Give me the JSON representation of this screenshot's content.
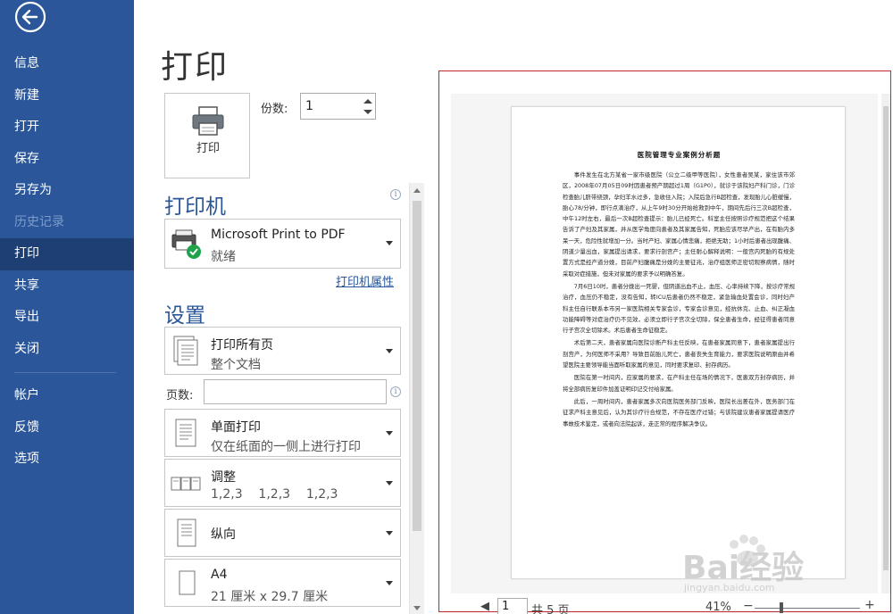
{
  "sidebar": {
    "items": [
      {
        "label": "信息",
        "state": "normal"
      },
      {
        "label": "新建",
        "state": "normal"
      },
      {
        "label": "打开",
        "state": "normal"
      },
      {
        "label": "保存",
        "state": "normal"
      },
      {
        "label": "另存为",
        "state": "normal"
      },
      {
        "label": "历史记录",
        "state": "disabled"
      },
      {
        "label": "打印",
        "state": "active"
      },
      {
        "label": "共享",
        "state": "normal"
      },
      {
        "label": "导出",
        "state": "normal"
      },
      {
        "label": "关闭",
        "state": "normal"
      }
    ],
    "lower_items": [
      {
        "label": "帐户"
      },
      {
        "label": "反馈"
      },
      {
        "label": "选项"
      }
    ],
    "accent_color": "#2b579a"
  },
  "main": {
    "title": "打印",
    "print_button_label": "打印",
    "copies_label": "份数:",
    "copies_value": "1",
    "printer_section_title": "打印机",
    "printer": {
      "name": "Microsoft Print to PDF",
      "status": "就绪"
    },
    "printer_properties_link": "打印机属性",
    "settings_section_title": "设置",
    "settings": {
      "range": {
        "title": "打印所有页",
        "subtitle": "整个文档"
      },
      "pages_label": "页数:",
      "pages_value": "",
      "sides": {
        "title": "单面打印",
        "subtitle": "仅在纸面的一侧上进行打印"
      },
      "collate": {
        "title": "调整",
        "subtitle": "1,2,3    1,2,3    1,2,3"
      },
      "orientation": {
        "title": "纵向"
      },
      "paper": {
        "title": "A4",
        "subtitle": "21 厘米 x 29.7 厘米"
      }
    }
  },
  "preview": {
    "document_title": "医院管理专业案例分析题",
    "paragraphs": [
      "事件发生在北方某省一家市级医院（公立二级甲等医院），女性患者吴某，家住该市郊区，2008年07月05日09时因患者预产期超过1周（G1P0），就诊于该院妇产科门诊，门诊检查胎儿脐带绕颈，孕妇羊水过多，急收住入院；入院后急行B超检查，发现胎儿心脏缓慢，胎心78/分钟，即行点滴治疗，从上午9时30分开始抢救到中午，期间先后行三次B超检查，中午12时左右，最后一次B超检查提示：胎儿已经死亡。科室主任按照诊疗规范把这个结果告诉了产妇及其家属，并从医学角度向患者及其家属告知，死胎应该尽早产出，在有胎内多呆一天，危险性就增加一分。当时产妇、家属心情悲痛，拒绝无助；1小时后患者出现腹痛、阴道少量出血，家属提出请求，要求行剖宫产；主任耐心解释说明：一般宫内死胎的有规处置方式是经产道分娩，目前产妇腹痛是分娩的主要征兆，治疗组医师正密切观察病情，随时采取对症措施，但未对家属的要求予以明确答复。",
      "7月6日10时，患者分娩出一死婴，但阴道出血不止，血压、心率持续下降，按诊疗常规治疗，血压仍不稳定，没有告知，转ICU后患者仍然不稳定，紧急输血处置会诊，同时妇产科主任自行联系本市另一家医院相关专家会诊，专家会诊意见，经抗休克、止血、纠正凝血功能障碍等对症治疗仍不见效，必须立即行子宫次全切除，保全患者生命，经征得患者同意行子宫次全切除术。术后患者生命征稳定。",
      "术后第二天，患者家属向医院诊断产科主任反映，在患者家属同意下，患者家属提出行剖宫产，为何医师不采用？导致目前胎儿死亡，患者丧失生育能力，要求医院说明原由并希望医院主要领导能当面听取家属的意见，同时要求复印、封存病历。",
      "医院在第一时间内，应家属的要求，在产科主任在场的情况下，医患双方封存病历，并将全部病历复印件加盖证明印记交付给家属。",
      "此后，一周时间内，患者家属多次向医院医务部门反映，医院长出差在外，医务部门在征求产科主意见后，认为其诊疗行合规范，不存在医疗过错；与该院建议患者家属提请医疗事故技术鉴定，或者向法院起诉，走正常的程序解决争议。"
    ],
    "current_page": "1",
    "total_pages": "共 5 页",
    "zoom_level": "41%",
    "watermark_text": "Bai经验",
    "watermark_url": "jingyan.baidu.com"
  }
}
